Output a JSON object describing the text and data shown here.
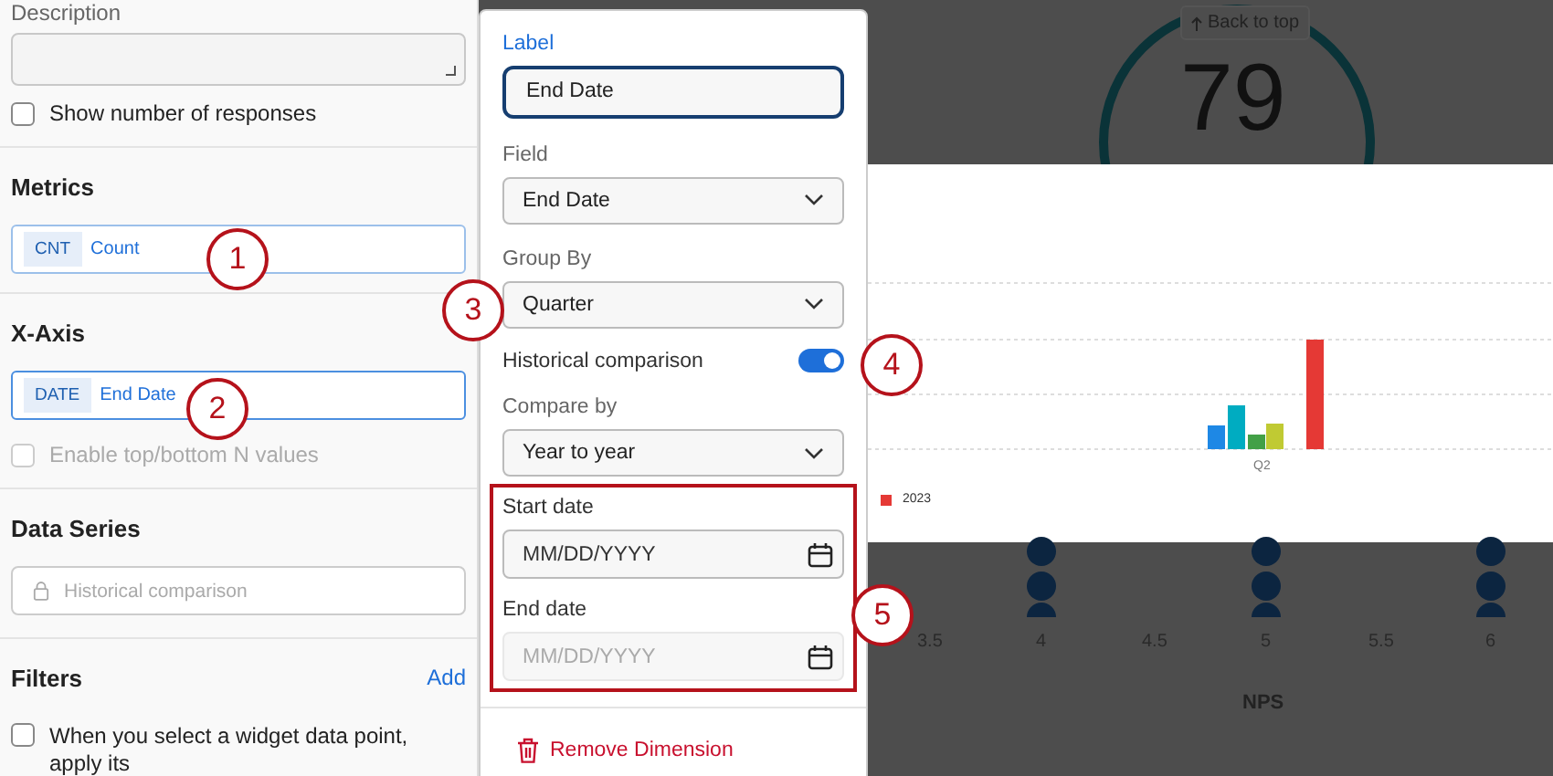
{
  "settings_panel": {
    "description_label": "Description",
    "show_responses": {
      "label": "Show number of responses",
      "checked": false
    },
    "metrics": {
      "title": "Metrics",
      "tag": "CNT",
      "value": "Count",
      "selected": false
    },
    "x_axis": {
      "title": "X-Axis",
      "tag": "DATE",
      "value": "End Date",
      "selected": true
    },
    "top_bottom": {
      "label": "Enable top/bottom N values",
      "checked": false,
      "disabled": true
    },
    "data_series": {
      "title": "Data Series",
      "placeholder": "Historical comparison"
    },
    "filters": {
      "title": "Filters",
      "add_link": "Add",
      "apply_filters": {
        "label": "When you select a widget data point, apply its",
        "checked": false
      }
    }
  },
  "dimension_popup": {
    "label": {
      "label": "Label",
      "value": "End Date"
    },
    "field": {
      "label": "Field",
      "value": "End Date"
    },
    "group_by": {
      "label": "Group By",
      "value": "Quarter"
    },
    "historical_comparison": {
      "label": "Historical comparison",
      "on": true
    },
    "compare_by": {
      "label": "Compare by",
      "value": "Year to year"
    },
    "start_date": {
      "label": "Start date",
      "placeholder": "MM/DD/YYYY",
      "disabled": false
    },
    "end_date": {
      "label": "End date",
      "placeholder": "MM/DD/YYYY",
      "disabled": true
    },
    "remove_button": "Remove Dimension"
  },
  "dashboard": {
    "back_to_top": "Back to top",
    "gauge_value": "79",
    "bar_chart": {
      "category": "Q2",
      "legend": {
        "label": "2023",
        "color": "#e53935"
      },
      "bars": [
        {
          "color": "#1e88e5"
        },
        {
          "color": "#00acc1"
        },
        {
          "color": "#43a047"
        },
        {
          "color": "#c0ca33"
        },
        {
          "color": "#e53935"
        }
      ]
    },
    "scatter": {
      "x_ticks": [
        "3.5",
        "4",
        "4.5",
        "5",
        "5.5",
        "6"
      ],
      "x_label": "NPS"
    }
  },
  "callouts": [
    "1",
    "2",
    "3",
    "4",
    "5"
  ]
}
